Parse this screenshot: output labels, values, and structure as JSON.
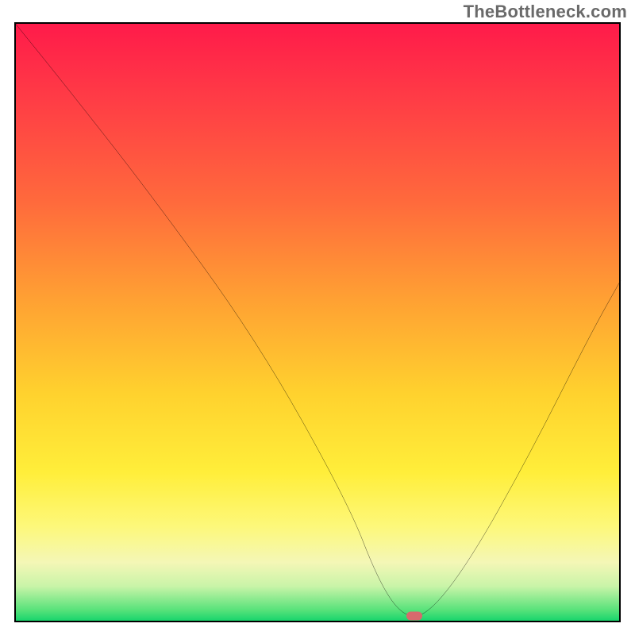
{
  "watermark": "TheBottleneck.com",
  "chart_data": {
    "type": "line",
    "title": "",
    "xlabel": "",
    "ylabel": "",
    "xlim": [
      0,
      100
    ],
    "ylim": [
      0,
      100
    ],
    "grid": false,
    "legend": false,
    "background_gradient": {
      "direction": "vertical",
      "stops": [
        {
          "pos": 0.0,
          "color": "#ff1a4a"
        },
        {
          "pos": 0.3,
          "color": "#ff6a3c"
        },
        {
          "pos": 0.62,
          "color": "#ffd22e"
        },
        {
          "pos": 0.84,
          "color": "#fdf87a"
        },
        {
          "pos": 0.94,
          "color": "#c9f4a8"
        },
        {
          "pos": 1.0,
          "color": "#0fd36a"
        }
      ]
    },
    "series": [
      {
        "name": "bottleneck-curve",
        "color": "#000000",
        "x": [
          0,
          8,
          22,
          40,
          55,
          60,
          64,
          68,
          75,
          85,
          95,
          100
        ],
        "y": [
          100,
          90,
          72,
          47,
          20,
          7,
          1,
          1,
          10,
          28,
          48,
          57
        ]
      }
    ],
    "markers": [
      {
        "name": "optimal-point",
        "x": 66,
        "y": 1,
        "color": "#d76a6d",
        "shape": "pill"
      }
    ]
  }
}
